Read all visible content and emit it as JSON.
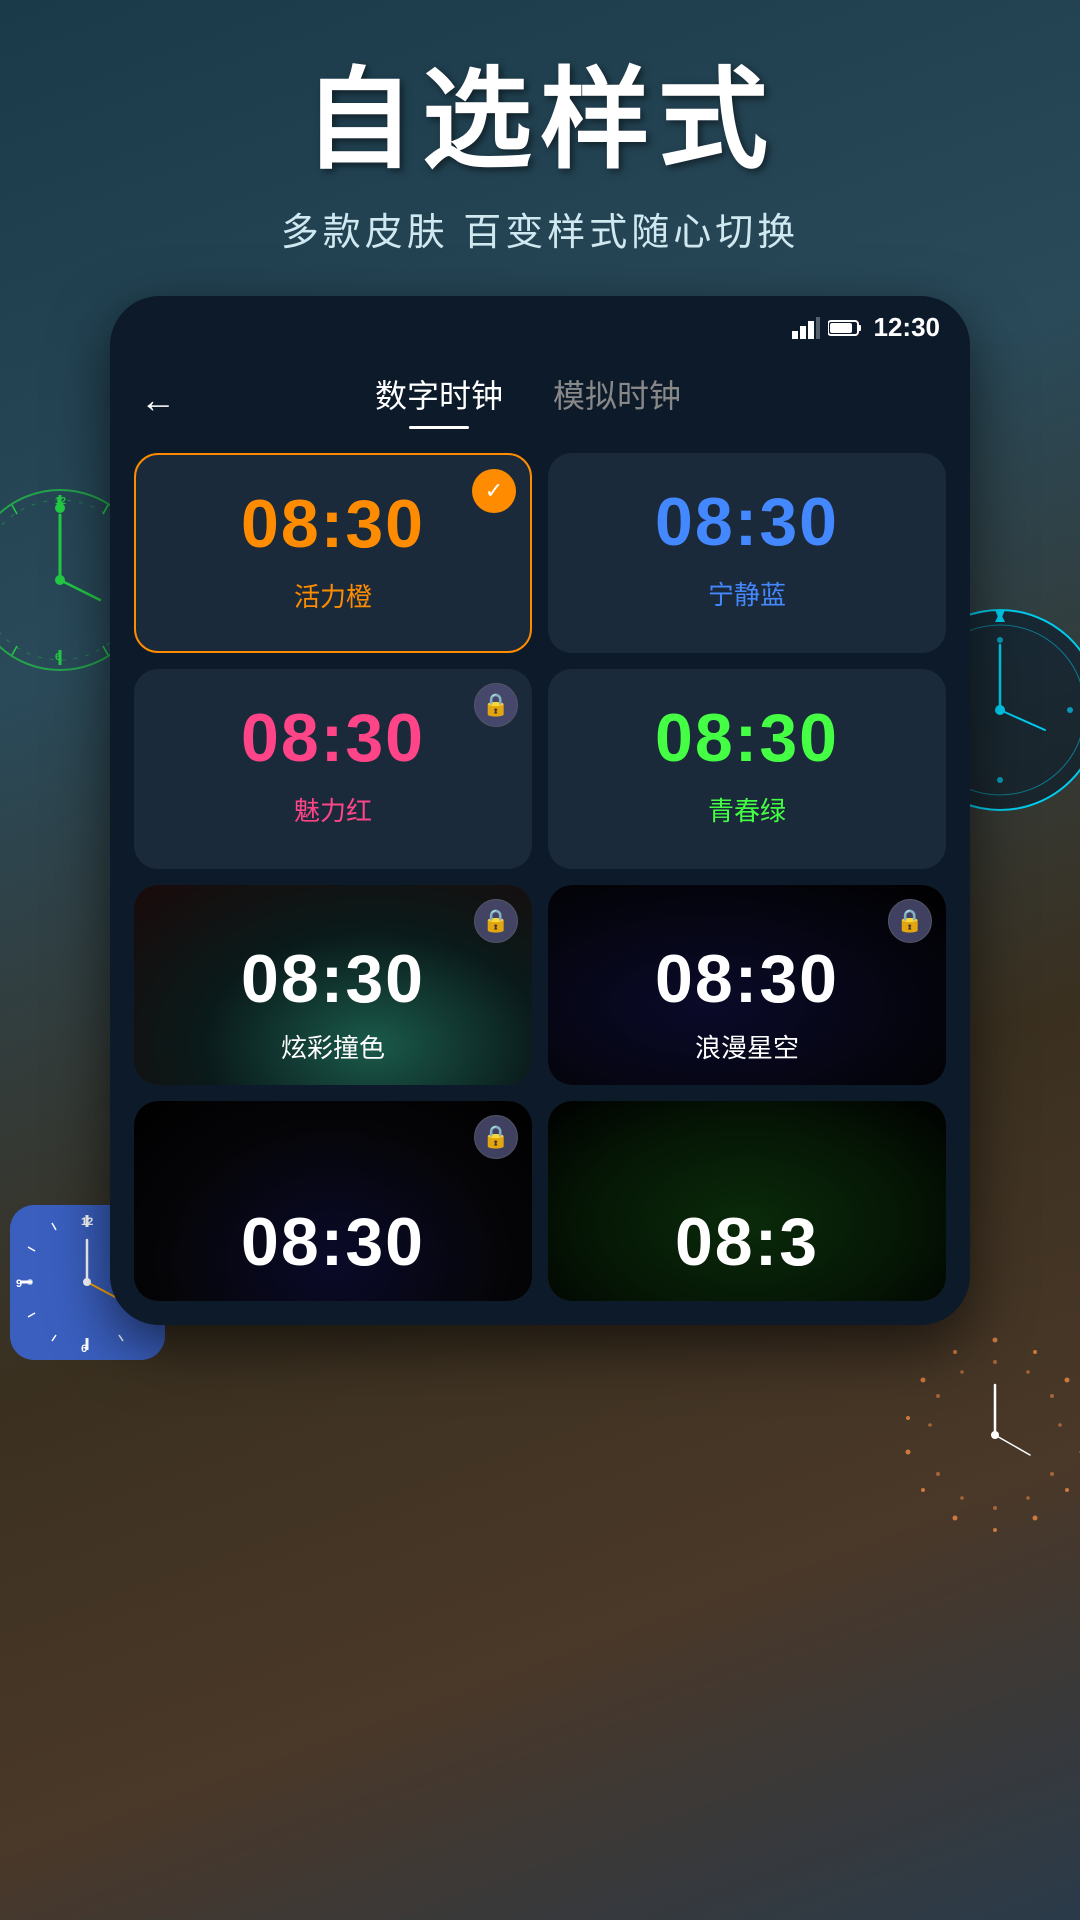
{
  "header": {
    "title": "自选样式",
    "subtitle": "多款皮肤 百变样式随心切换"
  },
  "statusBar": {
    "time": "12:30",
    "signal": "▲",
    "battery": "🔋"
  },
  "nav": {
    "backLabel": "←",
    "tab1": "数字时钟",
    "tab2": "模拟时钟"
  },
  "skins": [
    {
      "id": "orange",
      "time": "08:30",
      "label": "活力橙",
      "colorClass": "orange",
      "selected": true,
      "locked": false,
      "hasBg": false
    },
    {
      "id": "blue",
      "time": "08:30",
      "label": "宁静蓝",
      "colorClass": "blue",
      "selected": false,
      "locked": false,
      "hasBg": false
    },
    {
      "id": "pink",
      "time": "08:30",
      "label": "魅力红",
      "colorClass": "pink",
      "selected": false,
      "locked": true,
      "hasBg": false
    },
    {
      "id": "green",
      "time": "08:30",
      "label": "青春绿",
      "colorClass": "green",
      "selected": false,
      "locked": false,
      "hasBg": false
    },
    {
      "id": "dark-planet",
      "time": "08:30",
      "label": "炫彩撞色",
      "colorClass": "white",
      "selected": false,
      "locked": true,
      "hasBg": true,
      "bgClass": "dark-planet"
    },
    {
      "id": "space",
      "time": "08:30",
      "label": "浪漫星空",
      "colorClass": "white",
      "selected": false,
      "locked": true,
      "hasBg": true,
      "bgClass": "space"
    },
    {
      "id": "sparkle",
      "time": "08:30",
      "label": "",
      "colorClass": "white",
      "selected": false,
      "locked": true,
      "hasBg": true,
      "bgClass": "dark-sparkle"
    },
    {
      "id": "dark-green",
      "time": "08:3",
      "label": "",
      "colorClass": "white",
      "selected": false,
      "locked": false,
      "hasBg": true,
      "bgClass": "dark-green"
    }
  ],
  "icons": {
    "back": "←",
    "check": "✓",
    "lock": "🔒",
    "signal": "signal",
    "battery": "battery"
  }
}
